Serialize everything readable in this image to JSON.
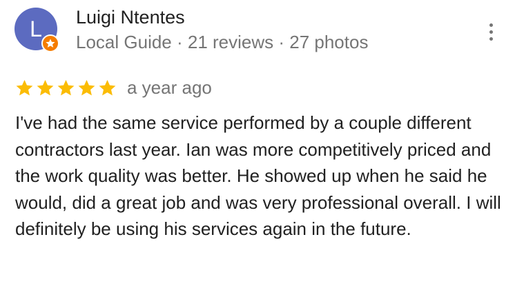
{
  "reviewer": {
    "avatar_initial": "L",
    "name": "Luigi Ntentes",
    "meta": "Local Guide · 21 reviews · 27 photos",
    "avatar_color": "#5c6bc0",
    "badge_color": "#f57c00"
  },
  "menu": {
    "icon": "more-vertical-icon"
  },
  "review": {
    "rating": 5,
    "rating_max": 5,
    "star_color": "#fbbc04",
    "date": "a year ago",
    "text": "I've had the same service performed by a couple different contractors last year. Ian was more competitively priced and the work quality was better. He showed up when he said he would, did a great job and was very professional overall. I will definitely be using his services again in the future."
  }
}
